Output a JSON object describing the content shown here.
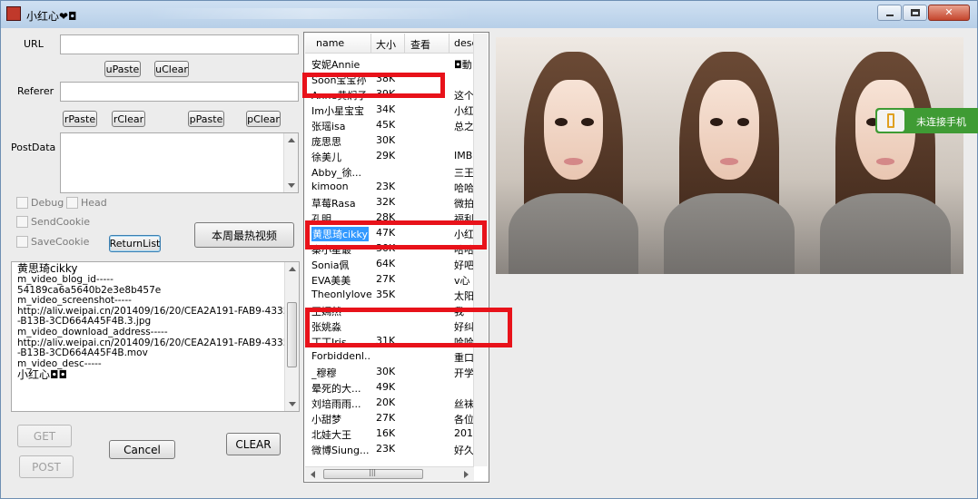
{
  "window": {
    "title": "小红心❤◘"
  },
  "inputs": {
    "url_label": "URL",
    "url_value": "",
    "referer_label": "Referer",
    "referer_value": "",
    "postdata_label": "PostData",
    "postdata_value": ""
  },
  "buttons": {
    "upaste": "uPaste",
    "uclear": "uClear",
    "rpaste": "rPaste",
    "rclear": "rClear",
    "ppaste": "pPaste",
    "pclear": "pClear",
    "returnlist": "ReturnList",
    "hot_videos": "本周最热视频",
    "get": "GET",
    "post": "POST",
    "cancel": "Cancel",
    "clear": "CLEAR"
  },
  "checkboxes": {
    "debug": "Debug",
    "head": "Head",
    "sendcookie": "SendCookie",
    "savecookie": "SaveCookie"
  },
  "output_log": [
    "黄思琦cikky",
    "m_video_blog_id-----",
    "54189ca6a5640b2e3e8b457e",
    "m_video_screenshot-----",
    "http://aliv.weipai.cn/201409/16/20/CEA2A191-FAB9-4335",
    "-B13B-3CD664A45F4B.3.jpg",
    "m_video_download_address-----",
    "http://aliv.weipai.cn/201409/16/20/CEA2A191-FAB9-4335",
    "-B13B-3CD664A45F4B.mov",
    "m_video_desc-----",
    "小红心◘◘"
  ],
  "list": {
    "columns": [
      "name",
      "大小",
      "查看",
      "desc"
    ],
    "rows": [
      {
        "name": "安妮Annie",
        "size": "",
        "view": "",
        "desc": "◘動"
      },
      {
        "name": "Soon宝宝孙",
        "size": "38K",
        "view": "",
        "desc": ""
      },
      {
        "name": "Anne黄焖子",
        "size": "39K",
        "view": "",
        "desc": "这个"
      },
      {
        "name": "Im小星宝宝",
        "size": "34K",
        "view": "",
        "desc": "小红"
      },
      {
        "name": "张瑶isa",
        "size": "45K",
        "view": "",
        "desc": "总之"
      },
      {
        "name": "庞思思",
        "size": "30K",
        "view": "",
        "desc": ""
      },
      {
        "name": "徐美儿",
        "size": "29K",
        "view": "",
        "desc": "IMBI"
      },
      {
        "name": "Abby_徐...",
        "size": "",
        "view": "",
        "desc": "三王"
      },
      {
        "name": "kimoon",
        "size": "23K",
        "view": "",
        "desc": "哈哈"
      },
      {
        "name": "草莓Rasa",
        "size": "32K",
        "view": "",
        "desc": "微拍"
      },
      {
        "name": "孔明",
        "size": "28K",
        "view": "",
        "desc": "福利"
      },
      {
        "name": "黄思琦cikky",
        "size": "47K",
        "view": "",
        "desc": "小红"
      },
      {
        "name": "秦小星最",
        "size": "30K",
        "view": "",
        "desc": "哈哈"
      },
      {
        "name": "Sonia佩",
        "size": "64K",
        "view": "",
        "desc": "好吧"
      },
      {
        "name": "EVA美美",
        "size": "27K",
        "view": "",
        "desc": "v心"
      },
      {
        "name": "Theonlylove",
        "size": "35K",
        "view": "",
        "desc": "太阳"
      },
      {
        "name": "王嫣然",
        "size": "",
        "view": "",
        "desc": "我"
      },
      {
        "name": "张姚淼",
        "size": "",
        "view": "",
        "desc": "好纠"
      },
      {
        "name": "丁丁Iris",
        "size": "31K",
        "view": "",
        "desc": "哈哈"
      },
      {
        "name": "Forbiddenl...",
        "size": "",
        "view": "",
        "desc": "重口"
      },
      {
        "name": "_穆穆",
        "size": "30K",
        "view": "",
        "desc": "开学"
      },
      {
        "name": "晕死的大...",
        "size": "49K",
        "view": "",
        "desc": ""
      },
      {
        "name": "刘培雨雨...",
        "size": "20K",
        "view": "",
        "desc": "丝袜"
      },
      {
        "name": "小甜梦",
        "size": "27K",
        "view": "",
        "desc": "各位"
      },
      {
        "name": "北娃大王",
        "size": "16K",
        "view": "",
        "desc": "201"
      },
      {
        "name": "微博Siung...",
        "size": "23K",
        "view": "",
        "desc": "好久"
      }
    ],
    "selected_index": 11
  },
  "phone_status": {
    "label": "未连接手机"
  },
  "colors": {
    "highlight_red": "#e8121a",
    "selection_blue": "#3399ff",
    "phone_green": "#3f9b34"
  }
}
